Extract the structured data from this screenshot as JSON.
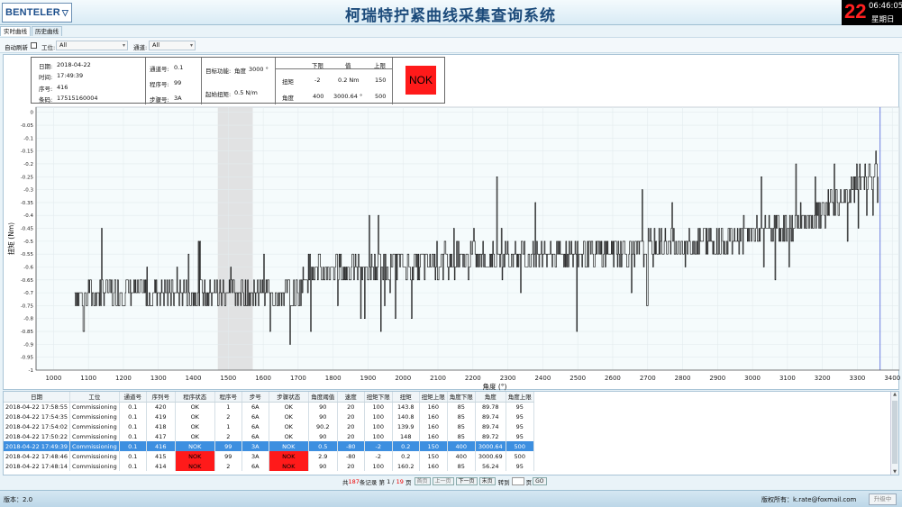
{
  "header": {
    "logo": "BENTELER",
    "title": "柯瑞特拧紧曲线采集查询系统"
  },
  "clock": {
    "day": "22",
    "time": "06:46:05",
    "weekday": "星期日"
  },
  "tabs": [
    {
      "label": "实时曲线",
      "active": true
    },
    {
      "label": "历史曲线",
      "active": false
    }
  ],
  "filters": {
    "auto_refresh_label": "自动刷新",
    "station_label": "工位:",
    "station_value": "All",
    "program_label": "通道:",
    "program_value": "All"
  },
  "info": {
    "date_label": "日期:",
    "date": "2018-04-22",
    "time_label": "时间:",
    "time": "17:49:39",
    "seq_label": "序号:",
    "seq": "416",
    "barcode_label": "条码:",
    "barcode": "17515160004",
    "channel_label": "通道号:",
    "channel": "0.1",
    "program_label": "程序号:",
    "program": "99",
    "step_label": "步骤号:",
    "step": "3A",
    "target_label": "目标功能:",
    "target_type": "角度",
    "target_value": "3000 °",
    "threshold_label": "起始扭矩:",
    "threshold_value": "0.5  N/m",
    "col_low": "下限",
    "col_val": "值",
    "col_high": "上限",
    "torque_label": "扭矩",
    "torque_low": "-2",
    "torque_val": "0.2 Nm",
    "torque_high": "150",
    "angle_label": "角度",
    "angle_low": "400",
    "angle_val": "3000.64 °",
    "angle_high": "500",
    "result": "NOK",
    "result_color": "#ff1a1a"
  },
  "chart_data": {
    "type": "line",
    "xlabel": "角度 (°)",
    "ylabel": "扭矩 (Nm)",
    "xlim": [
      950,
      3420
    ],
    "ylim": [
      -1.0,
      0.02
    ],
    "x_ticks": [
      1000,
      1100,
      1200,
      1300,
      1400,
      1500,
      1600,
      1700,
      1800,
      1900,
      2000,
      2100,
      2200,
      2300,
      2400,
      2500,
      2600,
      2700,
      2800,
      2900,
      3000,
      3100,
      3200,
      3300,
      3400
    ],
    "y_ticks": [
      "0",
      "-0.05",
      "-0.1",
      "-0.15",
      "-0.2",
      "-0.25",
      "-0.3",
      "-0.35",
      "-0.4",
      "-0.45",
      "-0.5",
      "-0.55",
      "-0.6",
      "-0.65",
      "-0.7",
      "-0.75",
      "-0.8",
      "-0.85",
      "-0.9",
      "-0.95",
      "-1"
    ],
    "series": [
      {
        "values_x": [
          1060,
          1700,
          1720,
          2100,
          2500,
          2900,
          3200,
          3360
        ],
        "values_y": [
          -0.7,
          -0.7,
          -0.62,
          -0.58,
          -0.55,
          -0.5,
          -0.4,
          -0.2
        ]
      }
    ],
    "shaded_window": [
      1470,
      1570
    ],
    "marker_x": 3365,
    "grid": true,
    "line_color": "#000000"
  },
  "table": {
    "headers": [
      "日期",
      "工位",
      "通道号",
      "序列号",
      "程序状态",
      "程序号",
      "步号",
      "步骤状态",
      "角度阈值",
      "速度",
      "扭矩下限",
      "扭矩",
      "扭矩上限",
      "角度下限",
      "角度",
      "角度上限"
    ],
    "rows": [
      {
        "cells": [
          "2018-04-22 17:58:55",
          "Commissioning",
          "0.1",
          "420",
          "OK",
          "1",
          "6A",
          "OK",
          "90",
          "20",
          "100",
          "143.8",
          "160",
          "85",
          "89.78",
          "95"
        ],
        "selected": false,
        "bad": []
      },
      {
        "cells": [
          "2018-04-22 17:54:35",
          "Commissioning",
          "0.1",
          "419",
          "OK",
          "2",
          "6A",
          "OK",
          "90",
          "20",
          "100",
          "140.8",
          "160",
          "85",
          "89.74",
          "95"
        ],
        "selected": false,
        "bad": []
      },
      {
        "cells": [
          "2018-04-22 17:54:02",
          "Commissioning",
          "0.1",
          "418",
          "OK",
          "1",
          "6A",
          "OK",
          "90.2",
          "20",
          "100",
          "139.9",
          "160",
          "85",
          "89.74",
          "95"
        ],
        "selected": false,
        "bad": []
      },
      {
        "cells": [
          "2018-04-22 17:50:22",
          "Commissioning",
          "0.1",
          "417",
          "OK",
          "2",
          "6A",
          "OK",
          "90",
          "20",
          "100",
          "148",
          "160",
          "85",
          "89.72",
          "95"
        ],
        "selected": false,
        "bad": []
      },
      {
        "cells": [
          "2018-04-22 17:49:39",
          "Commissioning",
          "0.1",
          "416",
          "NOK",
          "99",
          "3A",
          "NOK",
          "0.5",
          "-80",
          "-2",
          "0.2",
          "150",
          "400",
          "3000.64",
          "500"
        ],
        "selected": true,
        "bad": []
      },
      {
        "cells": [
          "2018-04-22 17:48:46",
          "Commissioning",
          "0.1",
          "415",
          "NOK",
          "99",
          "3A",
          "NOK",
          "2.9",
          "-80",
          "-2",
          "0.2",
          "150",
          "400",
          "3000.69",
          "500"
        ],
        "selected": false,
        "bad": [
          4,
          7
        ]
      },
      {
        "cells": [
          "2018-04-22 17:48:14",
          "Commissioning",
          "0.1",
          "414",
          "NOK",
          "2",
          "6A",
          "NOK",
          "90",
          "20",
          "100",
          "160.2",
          "160",
          "85",
          "56.24",
          "95"
        ],
        "selected": false,
        "bad": [
          4,
          7
        ]
      }
    ]
  },
  "pager": {
    "total_prefix": "共",
    "total": "187",
    "total_suffix": "条记录",
    "page_prefix": "第",
    "page": "1",
    "page_sep": "/",
    "page_total": "19",
    "page_suffix": "页",
    "first": "首页",
    "prev": "上一页",
    "next": "下一页",
    "last": "末页",
    "goto_label": "转到",
    "goto_suffix": "页",
    "go": "GO"
  },
  "footer": {
    "version": "版本：2.0",
    "copyright": "版权所有：k.rate@foxmail.com",
    "upgrade": "升级中"
  }
}
